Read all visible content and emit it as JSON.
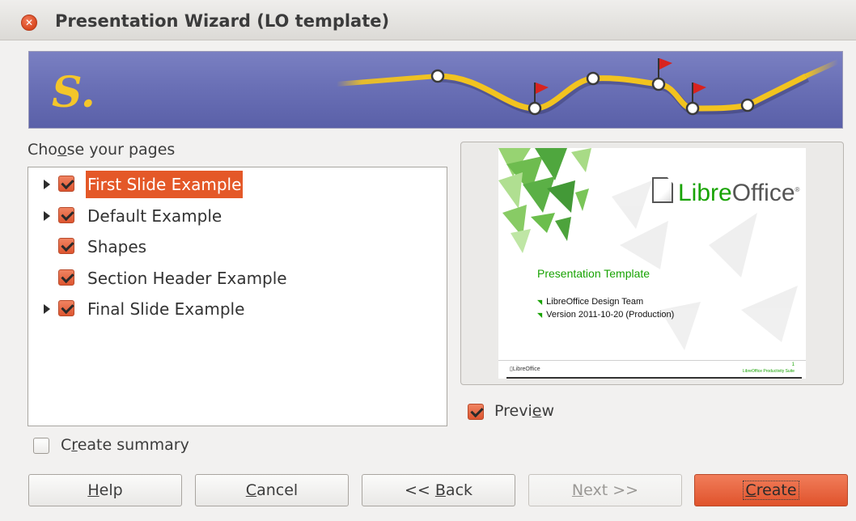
{
  "window": {
    "title": "Presentation Wizard (LO template)"
  },
  "banner": {
    "letter": "S."
  },
  "pages": {
    "label": "Choose your pages",
    "items": [
      {
        "label": "First Slide Example",
        "checked": true,
        "expandable": true,
        "selected": true
      },
      {
        "label": "Default Example",
        "checked": true,
        "expandable": true,
        "selected": false
      },
      {
        "label": "Shapes",
        "checked": true,
        "expandable": false,
        "selected": false
      },
      {
        "label": "Section Header Example",
        "checked": true,
        "expandable": false,
        "selected": false
      },
      {
        "label": "Final Slide Example",
        "checked": true,
        "expandable": true,
        "selected": false
      }
    ]
  },
  "summary": {
    "label": "Create summary",
    "checked": false
  },
  "preview": {
    "label": "Preview",
    "checked": true,
    "slide": {
      "logo_a": "Libre",
      "logo_b": "Office",
      "logo_mark": "®",
      "title": "Presentation Template",
      "bullets": [
        "LibreOffice Design Team",
        "Version 2011-10-20 (Production)"
      ],
      "footer_left": "LibreOffice",
      "footer_right": "LibreOffice Productivity Suite",
      "page_number": "1"
    }
  },
  "buttons": {
    "help": "Help",
    "cancel": "Cancel",
    "back": "<< Back",
    "next": "Next >>",
    "create": "Create"
  },
  "colors": {
    "accent": "#e45828",
    "banner": "#6a70b6",
    "track": "#f2c31f",
    "libre_green": "#18a303"
  }
}
